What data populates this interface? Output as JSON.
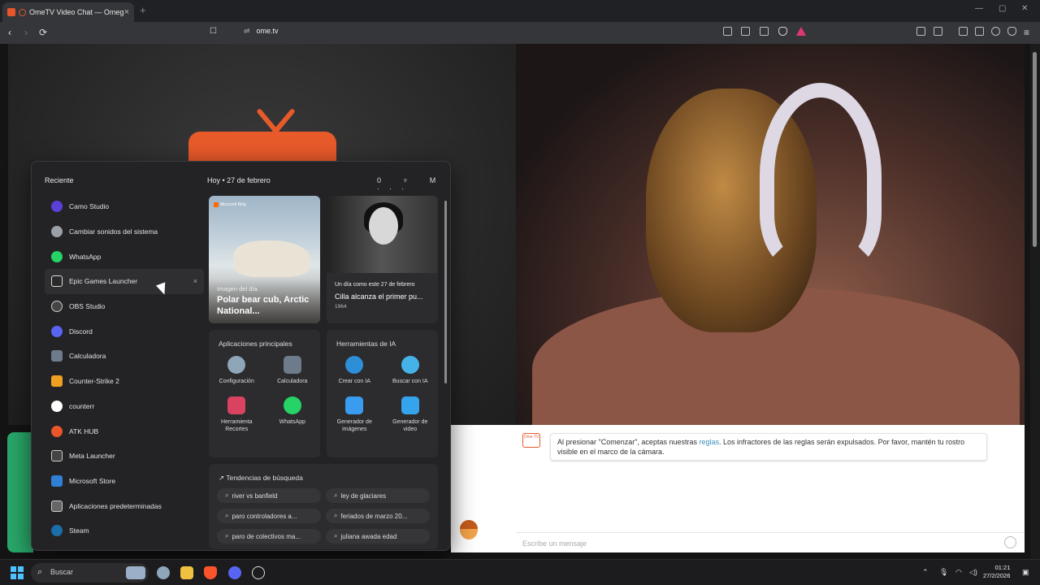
{
  "browser": {
    "tab_title": "OmeTV Video Chat — Omeg",
    "url": "ome.tv",
    "new_tab": "+",
    "close": "×",
    "nav": {
      "back": "‹",
      "forward": "›",
      "reload": "⟳",
      "bookmark": "☐"
    }
  },
  "chat": {
    "logo_text": "Ome TV",
    "message_pre": "Al presionar \"Comenzar\", aceptas nuestras ",
    "message_link": "reglas",
    "message_post": ". Los infractores de las reglas serán expulsados. Por favor, mantén tu rostro visible en el marco de la cámara.",
    "input_placeholder": "Escribe un mensaje"
  },
  "start_menu": {
    "recent_title": "Reciente",
    "recent_items": [
      {
        "label": "Camo Studio",
        "color": "#5b3fd9"
      },
      {
        "label": "Cambiar sonidos del sistema",
        "color": "#9aa0a6"
      },
      {
        "label": "WhatsApp",
        "color": "#25d366"
      },
      {
        "label": "Epic Games Launcher",
        "color": "#2a2a2a"
      },
      {
        "label": "OBS Studio",
        "color": "#444"
      },
      {
        "label": "Discord",
        "color": "#5865f2"
      },
      {
        "label": "Calculadora",
        "color": "#6d7b8a"
      },
      {
        "label": "Counter-Strike 2",
        "color": "#f0a020"
      },
      {
        "label": "counterr",
        "color": "#3a88e0"
      },
      {
        "label": "ATK HUB",
        "color": "#e8562a"
      },
      {
        "label": "Meta Launcher",
        "color": "#444"
      },
      {
        "label": "Microsoft Store",
        "color": "#2f7fd6"
      },
      {
        "label": "Aplicaciones predeterminadas",
        "color": "#666"
      },
      {
        "label": "Steam",
        "color": "#1b6ea8"
      }
    ],
    "close_glyph": "×",
    "today_prefix": "Hoy",
    "today_date": "27 de febrero",
    "header_icons": "0 ♆ M ···",
    "image_card": {
      "brand": "Microsoft Bing",
      "caption_small": "Imagen del día",
      "caption_big": "Polar bear cub, Arctic National..."
    },
    "history_card": {
      "caption_small": "Un día como este 27 de febrero",
      "caption_big": "Cilla alcanza el primer pu...",
      "year": "1964"
    },
    "main_apps": {
      "title": "Aplicaciones principales",
      "apps": [
        {
          "label": "Configuración",
          "color": "#8fa5b8"
        },
        {
          "label": "Calculadora",
          "color": "#6d7b8a"
        },
        {
          "label": "Herramienta Recortes",
          "color": "#d9435f"
        },
        {
          "label": "WhatsApp",
          "color": "#25d366"
        }
      ]
    },
    "ai_tools": {
      "title": "Herramientas de IA",
      "apps": [
        {
          "label": "Crear con IA",
          "color": "#2d8fd8"
        },
        {
          "label": "Buscar con IA",
          "color": "#46b3e8"
        },
        {
          "label": "Generador de imágenes",
          "color": "#3a9cf0"
        },
        {
          "label": "Generador de video",
          "color": "#35a4ec"
        }
      ]
    },
    "trends": {
      "title": "Tendencias de búsqueda",
      "items": [
        "river vs banfield",
        "ley de glaciares",
        "paro controladores a...",
        "feriados de marzo 20...",
        "paro de colectivos ma...",
        "juliana awada edad"
      ]
    }
  },
  "taskbar": {
    "search_placeholder": "Buscar",
    "time": "01:21",
    "date": "27/2/2026"
  }
}
